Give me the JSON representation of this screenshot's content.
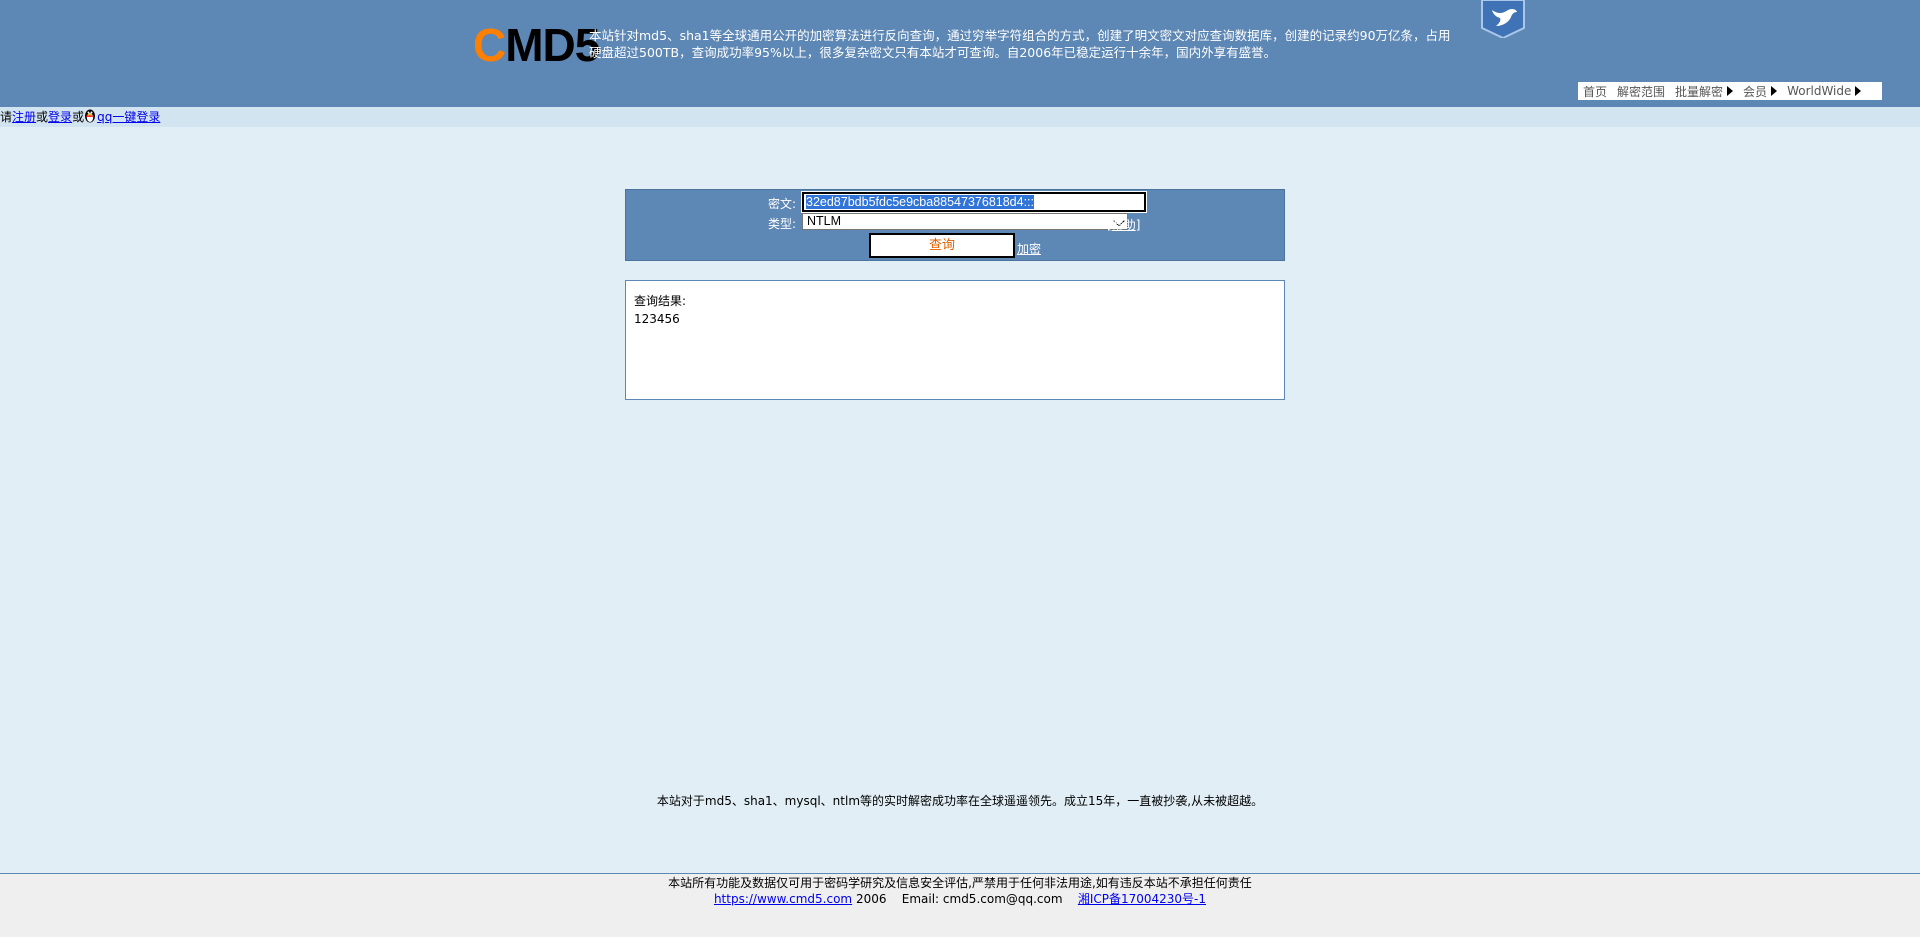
{
  "header": {
    "logo_c": "C",
    "logo_md5": "MD5",
    "intro": "本站针对md5、sha1等全球通用公开的加密算法进行反向查询，通过穷举字符组合的方式，创建了明文密文对应查询数据库，创建的记录约90万亿条，占用硬盘超过500TB，查询成功率95%以上，很多复杂密文只有本站才可查询。自2006年已稳定运行十余年，国内外享有盛誉。"
  },
  "topnav": {
    "home": "首页",
    "scope": "解密范围",
    "batch": "批量解密",
    "member": "会员",
    "worldwide": "WorldWide"
  },
  "loginbar": {
    "please": "请",
    "register": "注册",
    "or1": "或",
    "login": "登录",
    "or2": "或",
    "qq_login": "qq一键登录"
  },
  "form": {
    "cipher_label": "密文:",
    "cipher_value": "32ed87bdb5fdc5e9cba88547376818d4:::",
    "type_label": "类型:",
    "type_value": "NTLM",
    "help_open": "[",
    "help": "帮助",
    "help_close": "]",
    "query_button": "查询",
    "encrypt_link": "加密"
  },
  "result": {
    "label": "查询结果:",
    "value": "123456"
  },
  "footer": {
    "note": "本站对于md5、sha1、mysql、ntlm等的实时解密成功率在全球遥遥领先。成立15年，一直被抄袭,从未被超越。",
    "disclaimer": "本站所有功能及数据仅可用于密码学研究及信息安全评估,严禁用于任何非法用途,如有违反本站不承担任何责任",
    "site_link": "https://www.cmd5.com",
    "year": "2006",
    "email": "Email: cmd5.com@qq.com",
    "icp": "湘ICP备17004230号-1"
  },
  "colors": {
    "header_bg": "#5d87b4",
    "page_bg": "#e1eef6",
    "logo_accent": "#ff7f00",
    "query_text": "#e06000"
  }
}
